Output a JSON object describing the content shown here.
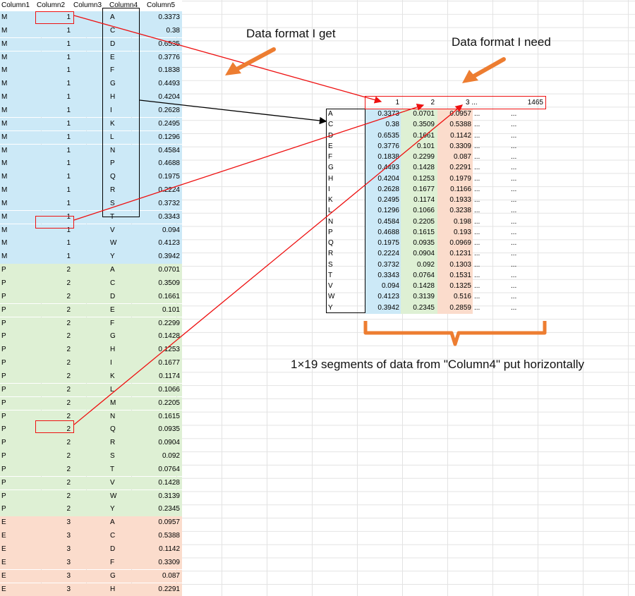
{
  "sheet": {
    "headers": [
      "Column1",
      "Column2",
      "Column3",
      "Column4",
      "Column5"
    ],
    "rows": [
      [
        "M",
        "1",
        "",
        "A",
        "0.3373"
      ],
      [
        "M",
        "1",
        "",
        "C",
        "0.38"
      ],
      [
        "M",
        "1",
        "",
        "D",
        "0.6535"
      ],
      [
        "M",
        "1",
        "",
        "E",
        "0.3776"
      ],
      [
        "M",
        "1",
        "",
        "F",
        "0.1838"
      ],
      [
        "M",
        "1",
        "",
        "G",
        "0.4493"
      ],
      [
        "M",
        "1",
        "",
        "H",
        "0.4204"
      ],
      [
        "M",
        "1",
        "",
        "I",
        "0.2628"
      ],
      [
        "M",
        "1",
        "",
        "K",
        "0.2495"
      ],
      [
        "M",
        "1",
        "",
        "L",
        "0.1296"
      ],
      [
        "M",
        "1",
        "",
        "N",
        "0.4584"
      ],
      [
        "M",
        "1",
        "",
        "P",
        "0.4688"
      ],
      [
        "M",
        "1",
        "",
        "Q",
        "0.1975"
      ],
      [
        "M",
        "1",
        "",
        "R",
        "0.2224"
      ],
      [
        "M",
        "1",
        "",
        "S",
        "0.3732"
      ],
      [
        "M",
        "1",
        "",
        "T",
        "0.3343"
      ],
      [
        "M",
        "1",
        "",
        "V",
        "0.094"
      ],
      [
        "M",
        "1",
        "",
        "W",
        "0.4123"
      ],
      [
        "M",
        "1",
        "",
        "Y",
        "0.3942"
      ],
      [
        "P",
        "2",
        "",
        "A",
        "0.0701"
      ],
      [
        "P",
        "2",
        "",
        "C",
        "0.3509"
      ],
      [
        "P",
        "2",
        "",
        "D",
        "0.1661"
      ],
      [
        "P",
        "2",
        "",
        "E",
        "0.101"
      ],
      [
        "P",
        "2",
        "",
        "F",
        "0.2299"
      ],
      [
        "P",
        "2",
        "",
        "G",
        "0.1428"
      ],
      [
        "P",
        "2",
        "",
        "H",
        "0.1253"
      ],
      [
        "P",
        "2",
        "",
        "I",
        "0.1677"
      ],
      [
        "P",
        "2",
        "",
        "K",
        "0.1174"
      ],
      [
        "P",
        "2",
        "",
        "L",
        "0.1066"
      ],
      [
        "P",
        "2",
        "",
        "M",
        "0.2205"
      ],
      [
        "P",
        "2",
        "",
        "N",
        "0.1615"
      ],
      [
        "P",
        "2",
        "",
        "Q",
        "0.0935"
      ],
      [
        "P",
        "2",
        "",
        "R",
        "0.0904"
      ],
      [
        "P",
        "2",
        "",
        "S",
        "0.092"
      ],
      [
        "P",
        "2",
        "",
        "T",
        "0.0764"
      ],
      [
        "P",
        "2",
        "",
        "V",
        "0.1428"
      ],
      [
        "P",
        "2",
        "",
        "W",
        "0.3139"
      ],
      [
        "P",
        "2",
        "",
        "Y",
        "0.2345"
      ],
      [
        "E",
        "3",
        "",
        "A",
        "0.0957"
      ],
      [
        "E",
        "3",
        "",
        "C",
        "0.5388"
      ],
      [
        "E",
        "3",
        "",
        "D",
        "0.1142"
      ],
      [
        "E",
        "3",
        "",
        "F",
        "0.3309"
      ],
      [
        "E",
        "3",
        "",
        "G",
        "0.087"
      ],
      [
        "E",
        "3",
        "",
        "H",
        "0.2291"
      ]
    ],
    "group_colors": {
      "M": "#cce9f7",
      "P": "#def0d4",
      "E": "#fbdccc"
    }
  },
  "target": {
    "headers": [
      "1",
      "2",
      "3 ...",
      "",
      "1465"
    ],
    "rows": [
      [
        "A",
        "0.3373",
        "0.0701",
        "0.0957",
        "...",
        "..."
      ],
      [
        "C",
        "0.38",
        "0.3509",
        "0.5388",
        "...",
        "..."
      ],
      [
        "D",
        "0.6535",
        "0.1661",
        "0.1142",
        "...",
        "..."
      ],
      [
        "E",
        "0.3776",
        "0.101",
        "0.3309",
        "...",
        "..."
      ],
      [
        "F",
        "0.1838",
        "0.2299",
        "0.087",
        "...",
        "..."
      ],
      [
        "G",
        "0.4493",
        "0.1428",
        "0.2291",
        "...",
        "..."
      ],
      [
        "H",
        "0.4204",
        "0.1253",
        "0.1979",
        "...",
        "..."
      ],
      [
        "I",
        "0.2628",
        "0.1677",
        "0.1166",
        "...",
        "..."
      ],
      [
        "K",
        "0.2495",
        "0.1174",
        "0.1933",
        "...",
        "..."
      ],
      [
        "L",
        "0.1296",
        "0.1066",
        "0.3238",
        "...",
        "..."
      ],
      [
        "N",
        "0.4584",
        "0.2205",
        "0.198",
        "...",
        "..."
      ],
      [
        "P",
        "0.4688",
        "0.1615",
        "0.193",
        "...",
        "..."
      ],
      [
        "Q",
        "0.1975",
        "0.0935",
        "0.0969",
        "...",
        "..."
      ],
      [
        "R",
        "0.2224",
        "0.0904",
        "0.1231",
        "...",
        "..."
      ],
      [
        "S",
        "0.3732",
        "0.092",
        "0.1303",
        "...",
        "..."
      ],
      [
        "T",
        "0.3343",
        "0.0764",
        "0.1531",
        "...",
        "..."
      ],
      [
        "V",
        "0.094",
        "0.1428",
        "0.1325",
        "...",
        "..."
      ],
      [
        "W",
        "0.4123",
        "0.3139",
        "0.516",
        "...",
        "..."
      ],
      [
        "Y",
        "0.3942",
        "0.2345",
        "0.2859",
        "...",
        "..."
      ]
    ],
    "col_colors": [
      "#cce9f7",
      "#def0d4",
      "#fbdccc"
    ]
  },
  "annotations": {
    "get_label": "Data format I get",
    "need_label": "Data format I need",
    "segments_label": "1×19 segments of data from \"Column4\" put horizontally"
  },
  "colors": {
    "arrow_red": "#ee1111",
    "arrow_orange": "#ed7d31",
    "box_black": "#000000"
  }
}
